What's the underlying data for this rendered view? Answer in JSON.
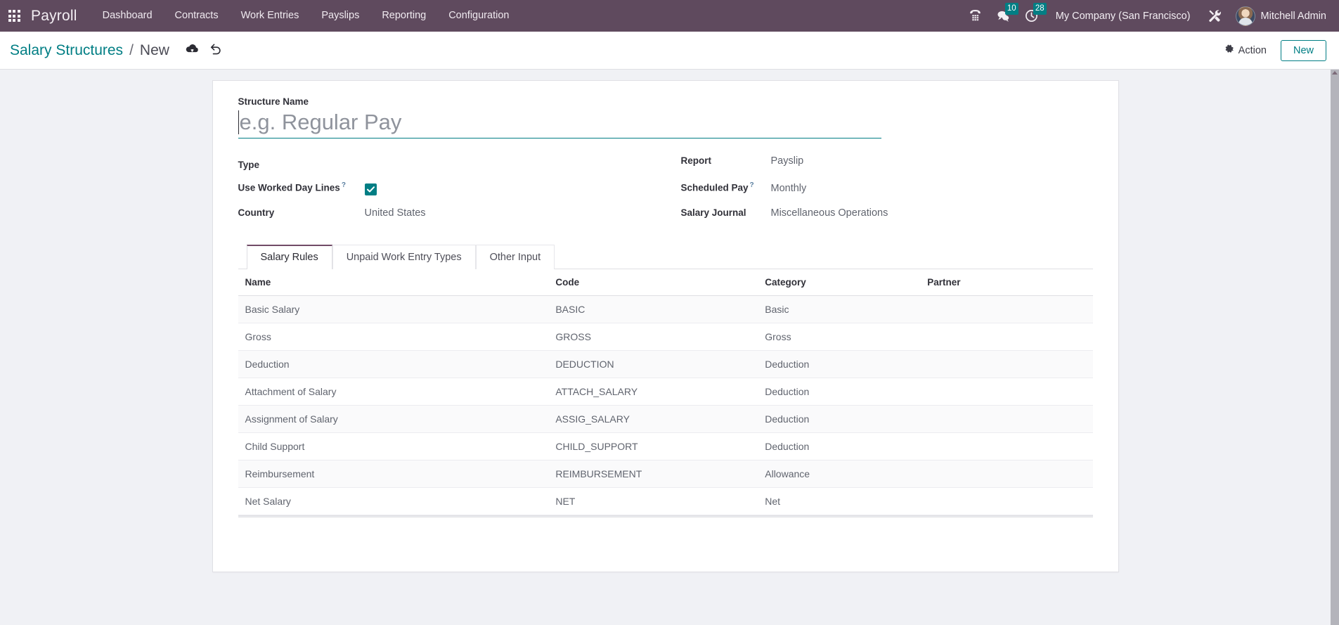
{
  "navbar": {
    "apps_icon": "apps-grid-icon",
    "brand": "Payroll",
    "menu": [
      {
        "label": "Dashboard"
      },
      {
        "label": "Contracts"
      },
      {
        "label": "Work Entries"
      },
      {
        "label": "Payslips"
      },
      {
        "label": "Reporting"
      },
      {
        "label": "Configuration"
      }
    ],
    "icons": {
      "voip": "phone-dialpad-icon",
      "messages": "chat-bubble-icon",
      "activities": "clock-icon",
      "tools": "tools-icon"
    },
    "messages_count": "10",
    "activities_count": "28",
    "company": "My Company (San Francisco)",
    "user": "Mitchell Admin",
    "accent_badge_color": "#017e84",
    "navbar_color": "#5f4a5e"
  },
  "control_panel": {
    "breadcrumb_root": "Salary Structures",
    "breadcrumb_separator": "/",
    "breadcrumb_current": "New",
    "save_icon": "cloud-upload-icon",
    "discard_icon": "undo-icon",
    "action_label": "Action",
    "action_icon": "gear-icon",
    "new_label": "New"
  },
  "form": {
    "title_label": "Structure Name",
    "title_value": "",
    "title_placeholder": "e.g. Regular Pay",
    "left_fields": [
      {
        "label": "Type",
        "value": "",
        "help": false
      },
      {
        "label": "Use Worked Day Lines",
        "value": "",
        "help": true,
        "type": "checkbox",
        "checked": true
      },
      {
        "label": "Country",
        "value": "United States",
        "help": false
      }
    ],
    "right_fields": [
      {
        "label": "Report",
        "value": "Payslip",
        "help": false
      },
      {
        "label": "Scheduled Pay",
        "value": "Monthly",
        "help": true
      },
      {
        "label": "Salary Journal",
        "value": "Miscellaneous Operations",
        "help": false
      }
    ]
  },
  "notebook": {
    "tabs": [
      {
        "label": "Salary Rules",
        "active": true
      },
      {
        "label": "Unpaid Work Entry Types",
        "active": false
      },
      {
        "label": "Other Input",
        "active": false
      }
    ]
  },
  "table": {
    "columns": [
      "Name",
      "Code",
      "Category",
      "Partner"
    ],
    "rows": [
      {
        "name": "Basic Salary",
        "code": "BASIC",
        "category": "Basic",
        "partner": ""
      },
      {
        "name": "Gross",
        "code": "GROSS",
        "category": "Gross",
        "partner": ""
      },
      {
        "name": "Deduction",
        "code": "DEDUCTION",
        "category": "Deduction",
        "partner": ""
      },
      {
        "name": "Attachment of Salary",
        "code": "ATTACH_SALARY",
        "category": "Deduction",
        "partner": ""
      },
      {
        "name": "Assignment of Salary",
        "code": "ASSIG_SALARY",
        "category": "Deduction",
        "partner": ""
      },
      {
        "name": "Child Support",
        "code": "CHILD_SUPPORT",
        "category": "Deduction",
        "partner": ""
      },
      {
        "name": "Reimbursement",
        "code": "REIMBURSEMENT",
        "category": "Allowance",
        "partner": ""
      },
      {
        "name": "Net Salary",
        "code": "NET",
        "category": "Net",
        "partner": ""
      }
    ]
  }
}
